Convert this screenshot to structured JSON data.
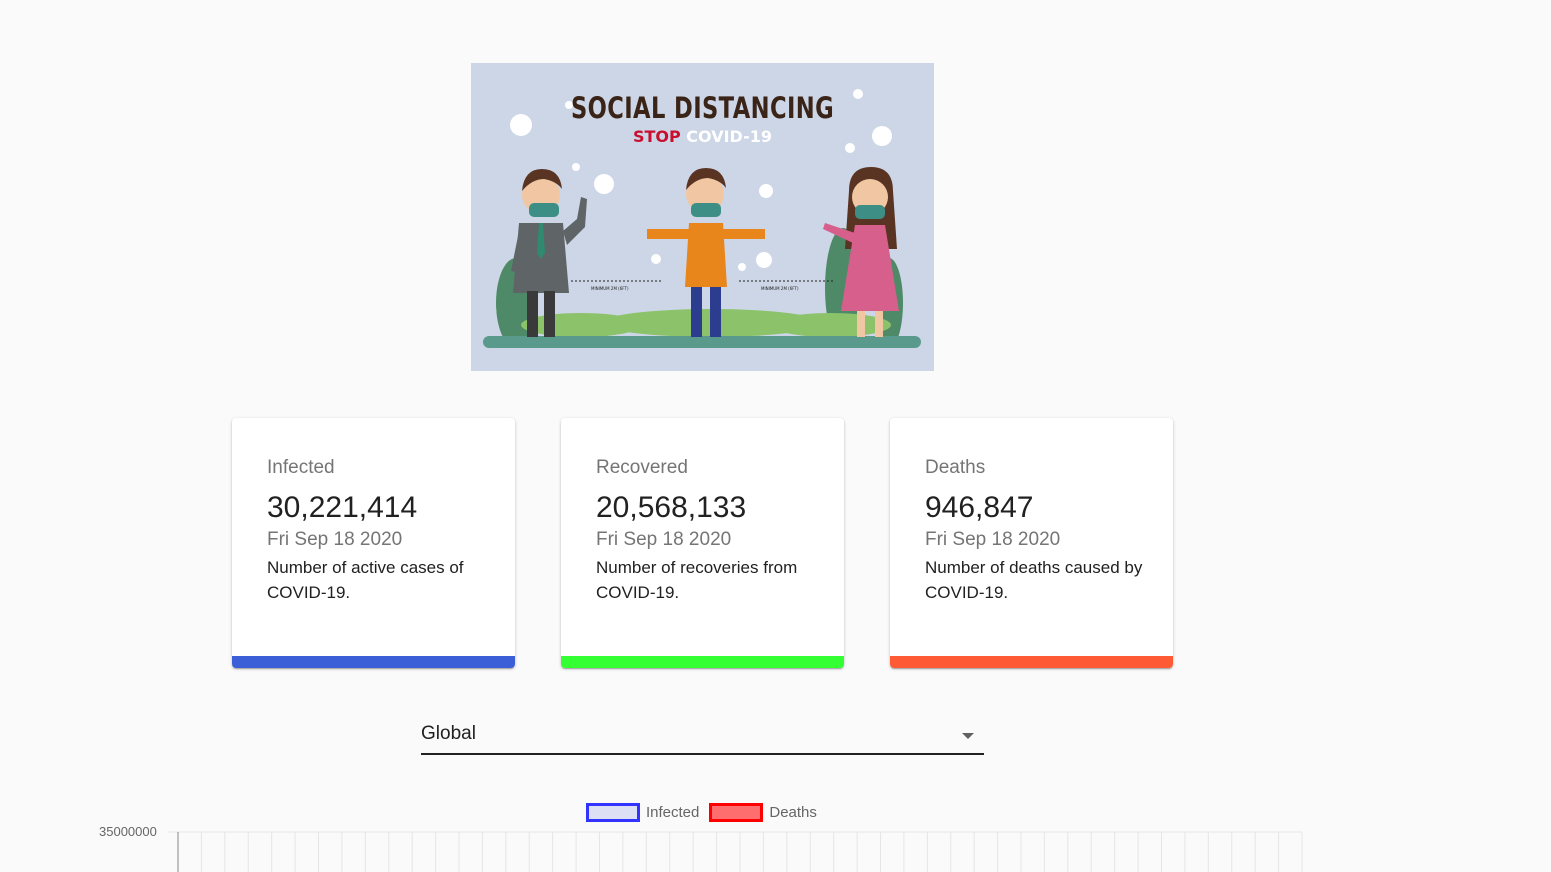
{
  "hero": {
    "title": "SOCIAL DISTANCING",
    "subtitle_stop": "STOP",
    "subtitle_covid": "COVID-19",
    "distance_note": "MINIMUM 2M (6FT)",
    "colors": {
      "bg": "#ccd6e6",
      "ground": "#5a9a8c"
    }
  },
  "cards": [
    {
      "label": "Infected",
      "value": "30,221,414",
      "date": "Fri Sep 18 2020",
      "description": "Number of active cases of COVID-19.",
      "accent": "#3b5fd6"
    },
    {
      "label": "Recovered",
      "value": "20,568,133",
      "date": "Fri Sep 18 2020",
      "description": "Number of recoveries from COVID-19.",
      "accent": "#33ff33"
    },
    {
      "label": "Deaths",
      "value": "946,847",
      "date": "Fri Sep 18 2020",
      "description": "Number of deaths caused by COVID-19.",
      "accent": "#ff5a36"
    }
  ],
  "country_select": {
    "selected": "Global",
    "icon": "chevron-down-icon"
  },
  "chart_data": {
    "type": "line",
    "legend_placement": "top-center",
    "series": [
      {
        "name": "Infected",
        "border": "#3333ff",
        "fill": "#dde0f5",
        "values": []
      },
      {
        "name": "Deaths",
        "border": "#ff0000",
        "fill": "#ff6e6e",
        "values": []
      }
    ],
    "yticks": [
      "35000000"
    ],
    "ylim_top": 35000000,
    "x_gridlines": 48,
    "grid": true
  }
}
